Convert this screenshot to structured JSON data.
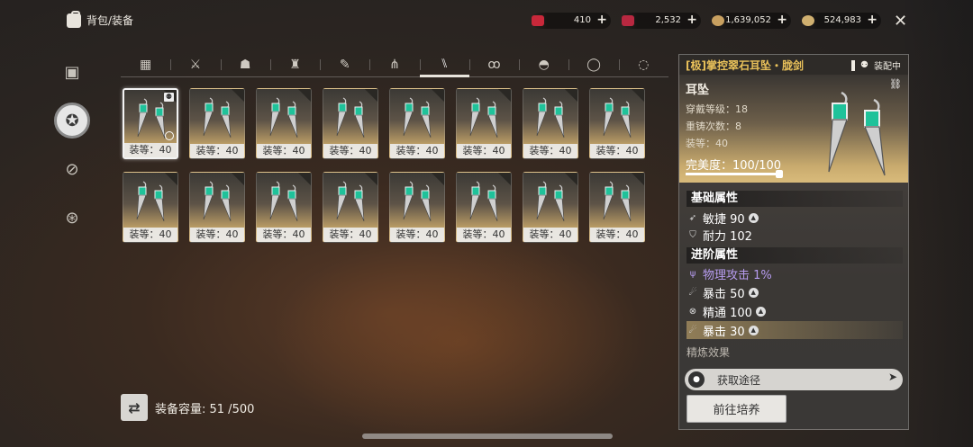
{
  "header": {
    "title": "背包/装备",
    "currencies": [
      {
        "icon": "red-gem-icon",
        "value": "410",
        "color": "#c8283a"
      },
      {
        "icon": "red-crystal-icon",
        "value": "2,532",
        "color": "#b82840"
      },
      {
        "icon": "coin-icon",
        "value": "1,639,052",
        "color": "#c8a060"
      },
      {
        "icon": "gold-coin-icon",
        "value": "524,983",
        "color": "#d0b070"
      }
    ],
    "plus_label": "+",
    "close_icon": "✕"
  },
  "left_nav": [
    {
      "name": "nav-bag-icon",
      "glyph": "▣",
      "active": false
    },
    {
      "name": "nav-equipment-icon",
      "glyph": "✪",
      "active": true
    },
    {
      "name": "nav-token-icon",
      "glyph": "⊘",
      "active": false
    },
    {
      "name": "nav-group-icon",
      "glyph": "⊛",
      "active": false
    }
  ],
  "category_tabs": [
    {
      "name": "tab-all",
      "glyph": "▦",
      "icon": "grid-icon"
    },
    {
      "name": "tab-weapon",
      "glyph": "⚔",
      "icon": "crossed-weapons-icon"
    },
    {
      "name": "tab-helmet",
      "glyph": "☗",
      "icon": "helmet-icon"
    },
    {
      "name": "tab-armor",
      "glyph": "♜",
      "icon": "armor-icon"
    },
    {
      "name": "tab-feather",
      "glyph": "✎",
      "icon": "feather-icon"
    },
    {
      "name": "tab-legs",
      "glyph": "⋔",
      "icon": "legs-icon"
    },
    {
      "name": "tab-earring",
      "glyph": "⑊",
      "icon": "earring-icon",
      "active": true
    },
    {
      "name": "tab-charm",
      "glyph": "ꝏ",
      "icon": "charm-icon"
    },
    {
      "name": "tab-bowl",
      "glyph": "◓",
      "icon": "bowl-icon"
    },
    {
      "name": "tab-ring",
      "glyph": "◯",
      "icon": "ring-icon"
    },
    {
      "name": "tab-ring-2",
      "glyph": "◌",
      "icon": "ring-alt-icon"
    }
  ],
  "items": [
    {
      "level": "装等：40",
      "selected": true,
      "equipped": true
    },
    {
      "level": "装等：40"
    },
    {
      "level": "装等：40"
    },
    {
      "level": "装等：40"
    },
    {
      "level": "装等：40"
    },
    {
      "level": "装等：40"
    },
    {
      "level": "装等：40"
    },
    {
      "level": "装等：40"
    },
    {
      "level": "装等：40"
    },
    {
      "level": "装等：40"
    },
    {
      "level": "装等：40"
    },
    {
      "level": "装等：40"
    },
    {
      "level": "装等：40"
    },
    {
      "level": "装等：40"
    },
    {
      "level": "装等：40"
    },
    {
      "level": "装等：40"
    }
  ],
  "capacity": {
    "label": "装备容量: 51 /500",
    "icon": "swap-icon"
  },
  "detail": {
    "name": "[极]掌控翠石耳坠・胧剑",
    "equipped_label": "装配中",
    "type": "耳坠",
    "wear_level": "穿戴等级：18",
    "reforge": "重铸次数：8",
    "gear_level": "装等：40",
    "perfection": "完美度：100/100",
    "perfection_value": 1.0,
    "base_title": "基础属性",
    "base_attrs": [
      {
        "icon": "agility-icon",
        "glyph": "➶",
        "text": "敏捷 90",
        "upgrade": true
      },
      {
        "icon": "endurance-icon",
        "glyph": "⛉",
        "text": "耐力 102",
        "upgrade": false
      }
    ],
    "adv_title": "进阶属性",
    "adv_attrs": [
      {
        "icon": "trident-icon",
        "glyph": "ψ",
        "text": "物理攻击 1%",
        "upgrade": false,
        "style": "purple"
      },
      {
        "icon": "crit-icon",
        "glyph": "☄",
        "text": "暴击 50",
        "upgrade": true
      },
      {
        "icon": "mastery-icon",
        "glyph": "⊗",
        "text": "精通 100",
        "upgrade": true
      },
      {
        "icon": "crit-icon",
        "glyph": "☄",
        "text": "暴击 30",
        "upgrade": true,
        "style": "highlight"
      }
    ],
    "refine_label": "精炼效果",
    "source_label": "获取途径",
    "goto_label": "前往培养"
  }
}
